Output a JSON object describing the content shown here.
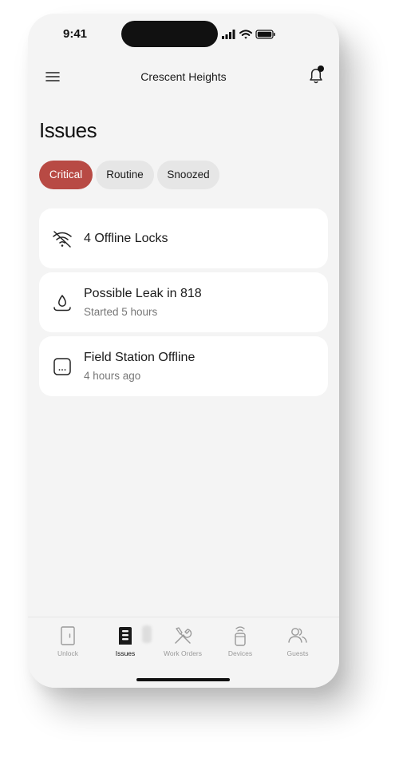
{
  "status_bar": {
    "time": "9:41"
  },
  "header": {
    "building_name": "Crescent Heights"
  },
  "page": {
    "title": "Issues"
  },
  "filters": [
    {
      "label": "Critical",
      "selected": true
    },
    {
      "label": "Routine",
      "selected": false
    },
    {
      "label": "Snoozed",
      "selected": false
    }
  ],
  "issues": [
    {
      "icon": "wifi-off-icon",
      "title": "4 Offline Locks",
      "subtitle": ""
    },
    {
      "icon": "water-drop-icon",
      "title": "Possible Leak in 818",
      "subtitle": "Started 5 hours"
    },
    {
      "icon": "device-offline-icon",
      "title": "Field Station Offline",
      "subtitle": "4 hours ago"
    }
  ],
  "tabs": [
    {
      "label": "Unlock",
      "icon": "door-icon",
      "active": false
    },
    {
      "label": "Issues",
      "icon": "issues-icon",
      "active": true
    },
    {
      "label": "Work Orders",
      "icon": "tools-icon",
      "active": false
    },
    {
      "label": "Devices",
      "icon": "device-icon",
      "active": false
    },
    {
      "label": "Guests",
      "icon": "guests-icon",
      "active": false
    }
  ],
  "colors": {
    "accent": "#b84a44",
    "background": "#f4f4f4",
    "card": "#ffffff",
    "chip": "#e6e6e6",
    "text_primary": "#1a1a1a",
    "text_secondary": "#777777"
  }
}
